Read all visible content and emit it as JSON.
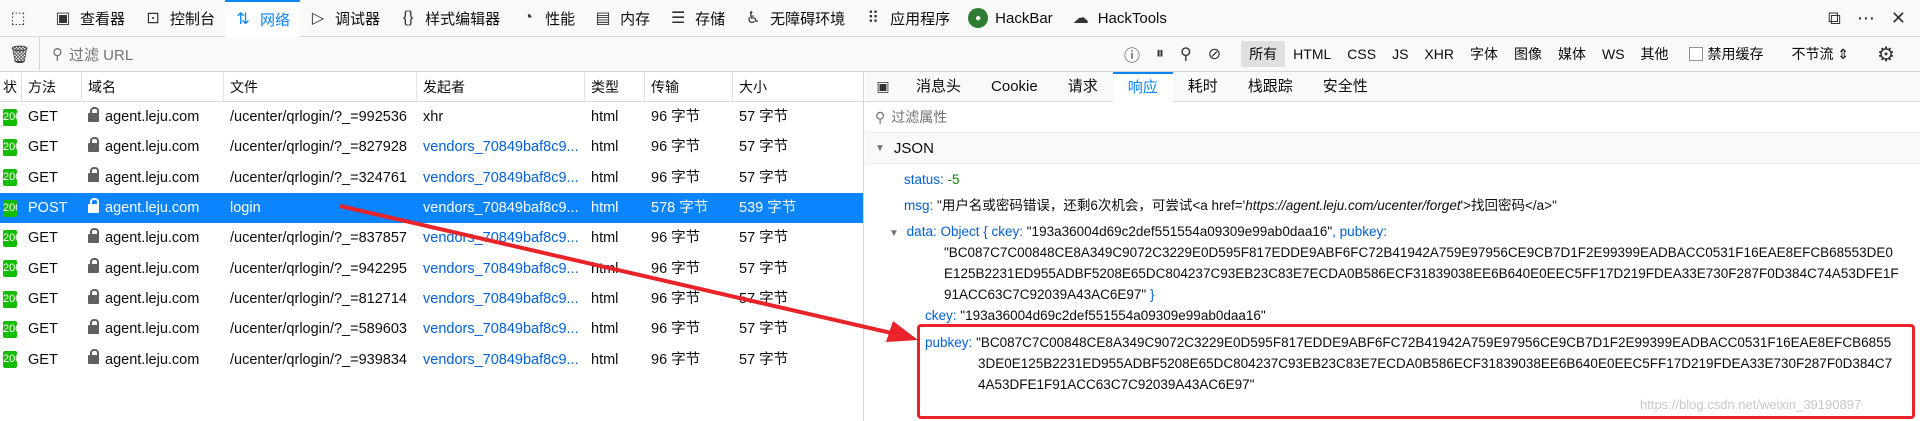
{
  "toolbar": {
    "tabs": [
      {
        "icon": "pick-element-icon",
        "label": ""
      },
      {
        "icon": "inspector-icon",
        "label": "查看器"
      },
      {
        "icon": "console-icon",
        "label": "控制台"
      },
      {
        "icon": "network-icon",
        "label": "网络"
      },
      {
        "icon": "debugger-icon",
        "label": "调试器"
      },
      {
        "icon": "style-editor-icon",
        "label": "样式编辑器"
      },
      {
        "icon": "performance-icon",
        "label": "性能"
      },
      {
        "icon": "memory-icon",
        "label": "内存"
      },
      {
        "icon": "storage-icon",
        "label": "存储"
      },
      {
        "icon": "accessibility-icon",
        "label": "无障碍环境"
      },
      {
        "icon": "application-icon",
        "label": "应用程序"
      },
      {
        "icon": "hackbar-icon",
        "label": "HackBar"
      },
      {
        "icon": "hacktools-icon",
        "label": "HackTools"
      }
    ],
    "active_tab": "网络"
  },
  "filterbar": {
    "url_placeholder": "过滤 URL",
    "type_filters": [
      "所有",
      "HTML",
      "CSS",
      "JS",
      "XHR",
      "字体",
      "图像",
      "媒体",
      "WS",
      "其他"
    ],
    "selected_type": "所有",
    "disable_cache_label": "禁用缓存",
    "throttle_label": "不节流 ⇕"
  },
  "table": {
    "headers": [
      "状",
      "方法",
      "域名",
      "文件",
      "发起者",
      "类型",
      "传输",
      "大小"
    ],
    "rows": [
      {
        "status": "200",
        "method": "GET",
        "domain": "agent.leju.com",
        "file": "/ucenter/qrlogin/?_=992536",
        "initiator": "xhr",
        "initiator_link": false,
        "type": "html",
        "transferred": "96 字节",
        "size": "57 字节",
        "selected": false
      },
      {
        "status": "200",
        "method": "GET",
        "domain": "agent.leju.com",
        "file": "/ucenter/qrlogin/?_=827928",
        "initiator": "vendors_70849baf8c9...",
        "initiator_link": true,
        "type": "html",
        "transferred": "96 字节",
        "size": "57 字节",
        "selected": false
      },
      {
        "status": "200",
        "method": "GET",
        "domain": "agent.leju.com",
        "file": "/ucenter/qrlogin/?_=324761",
        "initiator": "vendors_70849baf8c9...",
        "initiator_link": true,
        "type": "html",
        "transferred": "96 字节",
        "size": "57 字节",
        "selected": false
      },
      {
        "status": "200",
        "method": "POST",
        "domain": "agent.leju.com",
        "file": "login",
        "initiator": "vendors_70849baf8c9...",
        "initiator_link": true,
        "type": "html",
        "transferred": "578 字节",
        "size": "539 字节",
        "selected": true
      },
      {
        "status": "200",
        "method": "GET",
        "domain": "agent.leju.com",
        "file": "/ucenter/qrlogin/?_=837857",
        "initiator": "vendors_70849baf8c9...",
        "initiator_link": true,
        "type": "html",
        "transferred": "96 字节",
        "size": "57 字节",
        "selected": false
      },
      {
        "status": "200",
        "method": "GET",
        "domain": "agent.leju.com",
        "file": "/ucenter/qrlogin/?_=942295",
        "initiator": "vendors_70849baf8c9...",
        "initiator_link": true,
        "type": "html",
        "transferred": "96 字节",
        "size": "57 字节",
        "selected": false
      },
      {
        "status": "200",
        "method": "GET",
        "domain": "agent.leju.com",
        "file": "/ucenter/qrlogin/?_=812714",
        "initiator": "vendors_70849baf8c9...",
        "initiator_link": true,
        "type": "html",
        "transferred": "96 字节",
        "size": "57 字节",
        "selected": false
      },
      {
        "status": "200",
        "method": "GET",
        "domain": "agent.leju.com",
        "file": "/ucenter/qrlogin/?_=589603",
        "initiator": "vendors_70849baf8c9...",
        "initiator_link": true,
        "type": "html",
        "transferred": "96 字节",
        "size": "57 字节",
        "selected": false
      },
      {
        "status": "200",
        "method": "GET",
        "domain": "agent.leju.com",
        "file": "/ucenter/qrlogin/?_=939834",
        "initiator": "vendors_70849baf8c9...",
        "initiator_link": true,
        "type": "html",
        "transferred": "96 字节",
        "size": "57 字节",
        "selected": false
      }
    ]
  },
  "detail": {
    "tabs": [
      "消息头",
      "Cookie",
      "请求",
      "响应",
      "耗时",
      "栈跟踪",
      "安全性"
    ],
    "active_tab": "响应",
    "filter_placeholder": "过滤属性",
    "json_label": "JSON",
    "status_key": "status:",
    "status_val": "-5",
    "msg_key": "msg:",
    "msg_val_a": "\"用户名或密码错误，还剩6次机会，可尝试<a href='",
    "msg_val_link": "https://agent.leju.com/ucenter/forget",
    "msg_val_b": "'>找回密码</a>\"",
    "data_key": "data:",
    "data_summary_a": "Object { ckey: ",
    "data_summary_ckey": "\"193a36004d69c2def551554a09309e99ab0daa16\"",
    "data_summary_pubkey_key": ", pubkey:",
    "data_summary_line2": "\"BC087C7C00848CE8A349C9072C3229E0D595F817EDDE9ABF6FC72B41942A759E97956CE9CB7D1F2E99399EADBACC0531F16EAE8EFCB68553DE0",
    "data_summary_line3": "E125B2231ED955ADBF5208E65DC804237C93EB23C83E7ECDA0B586ECF31839038EE6B640E0EEC5FF17D219FDEA33E730F287F0D384C74A53DFE1F",
    "data_summary_line4": "91ACC63C7C92039A43AC6E97\"",
    "data_summary_close": " }",
    "ckey_key": "ckey:",
    "ckey_val": "\"193a36004d69c2def551554a09309e99ab0daa16\"",
    "pubkey_key": "pubkey:",
    "pubkey_line1": "\"BC087C7C00848CE8A349C9072C3229E0D595F817EDDE9ABF6FC72B41942A759E97956CE9CB7D1F2E99399EADBACC0531F16EAE8EFCB6855",
    "pubkey_line2": "3DE0E125B2231ED955ADBF5208E65DC804237C93EB23C83E7ECDA0B586ECF31839038EE6B640E0EEC5FF17D219FDEA33E730F287F0D384C7",
    "pubkey_line3": "4A53DFE1F91ACC63C7C92039A43AC6E97\""
  },
  "watermark": "https://blog.csdn.net/weixin_39190897",
  "colors": {
    "accent": "#0a84ff",
    "annotation": "#e8232a",
    "status_ok": "#12bc00"
  }
}
